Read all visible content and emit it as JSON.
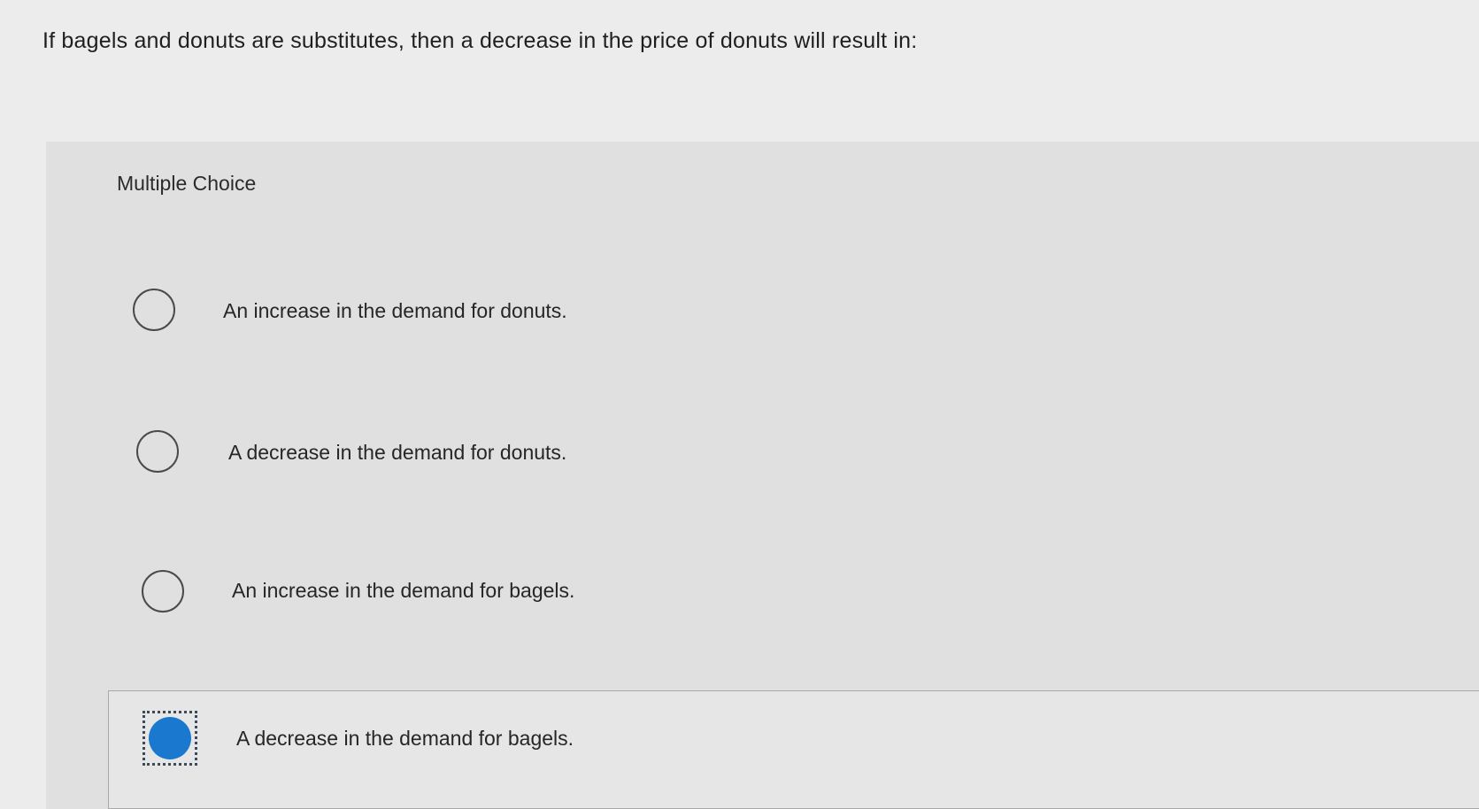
{
  "question": {
    "prompt": "If bagels and donuts are substitutes, then a decrease in the price of donuts will result in:"
  },
  "panel": {
    "heading": "Multiple Choice"
  },
  "options": [
    {
      "label": "An increase in the demand for donuts.",
      "selected": false
    },
    {
      "label": "A decrease in the demand for donuts.",
      "selected": false
    },
    {
      "label": "An increase in the demand for bagels.",
      "selected": false
    },
    {
      "label": "A decrease in the demand for bagels.",
      "selected": true
    }
  ],
  "colors": {
    "selected_radio": "#1a78cf",
    "panel_background": "#e0e0e0",
    "page_background": "#ececec"
  }
}
